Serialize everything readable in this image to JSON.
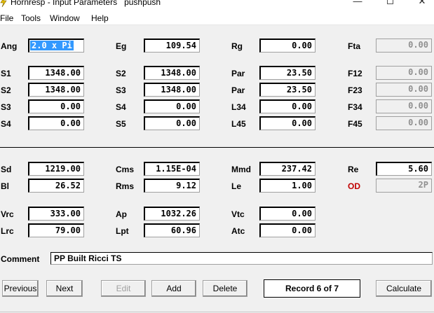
{
  "window": {
    "title": "Hornresp - Input Parameters   pushpush",
    "minimize_glyph": "—",
    "close_glyph": "✕"
  },
  "menu": [
    "File",
    "Tools",
    "Window",
    "Help"
  ],
  "params": {
    "Ang": {
      "label": "Ang",
      "value": "2.0 x Pi"
    },
    "Eg": {
      "label": "Eg",
      "value": "109.54"
    },
    "Rg": {
      "label": "Rg",
      "value": "0.00"
    },
    "Fta": {
      "label": "Fta",
      "value": "0.00"
    },
    "S1": {
      "label": "S1",
      "value": "1348.00"
    },
    "S2": {
      "label": "S2",
      "value": "1348.00"
    },
    "Par1": {
      "label": "Par",
      "value": "23.50"
    },
    "F12": {
      "label": "F12",
      "value": "0.00"
    },
    "S2b": {
      "label": "S2",
      "value": "1348.00"
    },
    "S3": {
      "label": "S3",
      "value": "1348.00"
    },
    "Par2": {
      "label": "Par",
      "value": "23.50"
    },
    "F23": {
      "label": "F23",
      "value": "0.00"
    },
    "S3b": {
      "label": "S3",
      "value": "0.00"
    },
    "S4": {
      "label": "S4",
      "value": "0.00"
    },
    "L34": {
      "label": "L34",
      "value": "0.00"
    },
    "F34": {
      "label": "F34",
      "value": "0.00"
    },
    "S4b": {
      "label": "S4",
      "value": "0.00"
    },
    "S5": {
      "label": "S5",
      "value": "0.00"
    },
    "L45": {
      "label": "L45",
      "value": "0.00"
    },
    "F45": {
      "label": "F45",
      "value": "0.00"
    },
    "Sd": {
      "label": "Sd",
      "value": "1219.00"
    },
    "Cms": {
      "label": "Cms",
      "value": "1.15E-04"
    },
    "Mmd": {
      "label": "Mmd",
      "value": "237.42"
    },
    "Re": {
      "label": "Re",
      "value": "5.60"
    },
    "Bl": {
      "label": "Bl",
      "value": "26.52"
    },
    "Rms": {
      "label": "Rms",
      "value": "9.12"
    },
    "Le": {
      "label": "Le",
      "value": "1.00"
    },
    "OD": {
      "label": "OD",
      "value": "2P"
    },
    "Vrc": {
      "label": "Vrc",
      "value": "333.00"
    },
    "Ap": {
      "label": "Ap",
      "value": "1032.26"
    },
    "Vtc": {
      "label": "Vtc",
      "value": "0.00"
    },
    "Lrc": {
      "label": "Lrc",
      "value": "79.00"
    },
    "Lpt": {
      "label": "Lpt",
      "value": "60.96"
    },
    "Atc": {
      "label": "Atc",
      "value": "0.00"
    }
  },
  "comment": {
    "label": "Comment",
    "value": "PP Built Ricci TS"
  },
  "buttons": {
    "previous": "Previous",
    "next": "Next",
    "edit": "Edit",
    "add": "Add",
    "delete": "Delete",
    "record": "Record 6 of 7",
    "calculate": "Calculate"
  },
  "colors": {
    "selection": "#3399ff",
    "od_label": "#c00000"
  }
}
